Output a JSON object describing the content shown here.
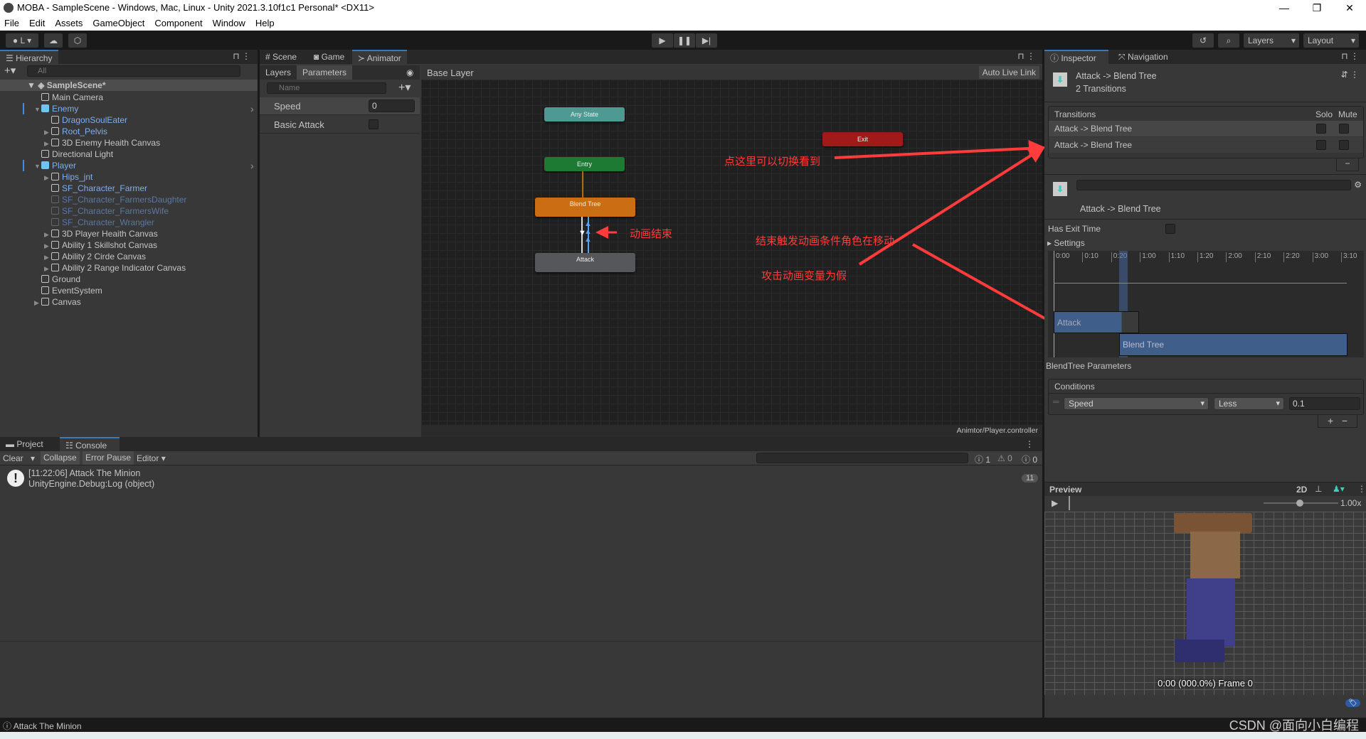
{
  "window": {
    "title": "MOBA - SampleScene - Windows, Mac, Linux - Unity 2021.3.10f1c1 Personal* <DX11>",
    "minimize": "—",
    "maximize": "❐",
    "close": "✕"
  },
  "menu": [
    "File",
    "Edit",
    "Assets",
    "GameObject",
    "Component",
    "Window",
    "Help"
  ],
  "toolbar": {
    "account": "L",
    "layers": "Layers",
    "layout": "Layout"
  },
  "hierarchy": {
    "tab": "Hierarchy",
    "search_placeholder": "All",
    "scene": "SampleScene*",
    "items": [
      {
        "label": "Main Camera",
        "depth": 1,
        "style": "normal",
        "expand": ""
      },
      {
        "label": "Enemy",
        "depth": 1,
        "style": "prefab",
        "expand": "▼"
      },
      {
        "label": "DragonSoulEater",
        "depth": 2,
        "style": "blue",
        "expand": ""
      },
      {
        "label": "Root_Pelvis",
        "depth": 2,
        "style": "blue",
        "expand": "▶"
      },
      {
        "label": "3D Enemy Heaith Canvas",
        "depth": 2,
        "style": "normal",
        "expand": "▶"
      },
      {
        "label": "Directional Light",
        "depth": 1,
        "style": "normal",
        "expand": ""
      },
      {
        "label": "Player",
        "depth": 1,
        "style": "prefab",
        "expand": "▼"
      },
      {
        "label": "Hips_jnt",
        "depth": 2,
        "style": "blue",
        "expand": "▶"
      },
      {
        "label": "SF_Character_Farmer",
        "depth": 2,
        "style": "blue",
        "expand": ""
      },
      {
        "label": "SF_Character_FarmersDaughter",
        "depth": 2,
        "style": "dim",
        "expand": ""
      },
      {
        "label": "SF_Character_FarmersWife",
        "depth": 2,
        "style": "dim",
        "expand": ""
      },
      {
        "label": "SF_Character_Wrangler",
        "depth": 2,
        "style": "dim",
        "expand": ""
      },
      {
        "label": "3D Player Heaith Canvas",
        "depth": 2,
        "style": "normal",
        "expand": "▶"
      },
      {
        "label": "Ability 1 Skillshot Canvas",
        "depth": 2,
        "style": "normal",
        "expand": "▶"
      },
      {
        "label": "Ability 2 Cirde Canvas",
        "depth": 2,
        "style": "normal",
        "expand": "▶"
      },
      {
        "label": "Ability 2 Range Indicator Canvas",
        "depth": 2,
        "style": "normal",
        "expand": "▶"
      },
      {
        "label": "Ground",
        "depth": 1,
        "style": "normal",
        "expand": ""
      },
      {
        "label": "EventSystem",
        "depth": 1,
        "style": "normal",
        "expand": ""
      },
      {
        "label": "Canvas",
        "depth": 1,
        "style": "normal",
        "expand": "▶"
      }
    ]
  },
  "animator": {
    "tabs": [
      "Scene",
      "Game",
      "Animator"
    ],
    "subtabs": [
      "Layers",
      "Parameters"
    ],
    "search_placeholder": "Name",
    "breadcrumb": "Base Layer",
    "auto_live_link": "Auto Live Link",
    "footer": "Animtor/Player.controller",
    "parameters": [
      {
        "name": "Speed",
        "value": "0"
      },
      {
        "name": "Basic Attack",
        "value": false
      }
    ],
    "nodes": {
      "any_state": "Any State",
      "exit": "Exit",
      "entry": "Entry",
      "blend_tree": "Blend Tree",
      "attack": "Attack"
    },
    "annotations": {
      "switch": "点这里可以切换看到",
      "end": "动画结束",
      "condition": "结束触发动画条件角色在移动",
      "false": "攻击动画变量为假"
    },
    "annotation_color": "#ff3b3b"
  },
  "console": {
    "tabs": [
      "Project",
      "Console"
    ],
    "buttons": [
      "Clear",
      "Collapse",
      "Error Pause",
      "Editor"
    ],
    "counts": {
      "log": "1",
      "warn": "0",
      "error": "0"
    },
    "entries": [
      {
        "line1": "[11:22:06] Attack The Minion",
        "line2": "UnityEngine.Debug:Log (object)",
        "count": "11"
      }
    ]
  },
  "status": "Attack The Minion",
  "inspector": {
    "tabs": [
      "Inspector",
      "Navigation"
    ],
    "title": "Attack -> Blend Tree",
    "subtitle": "2 Transitions",
    "transitions_header": "Transitions",
    "solo": "Solo",
    "mute": "Mute",
    "transitions": [
      "Attack -> Blend Tree",
      "Attack -> Blend Tree"
    ],
    "selected_name": "Attack -> Blend Tree",
    "has_exit_time": "Has Exit Time",
    "settings": "Settings",
    "timeline_ticks": [
      "0:00",
      "0:10",
      "0:20",
      "1:00",
      "1:10",
      "1:20",
      "2:00",
      "2:10",
      "2:20",
      "3:00",
      "3:10"
    ],
    "clips": {
      "from": "Attack",
      "to": "Blend Tree"
    },
    "blendtree_params": "BlendTree Parameters",
    "conditions_header": "Conditions",
    "condition": {
      "param": "Speed",
      "op": "Less",
      "value": "0.1"
    },
    "preview": {
      "label": "Preview",
      "mode": "2D",
      "speed": "1.00x",
      "frame": "0:00 (000.0%) Frame 0"
    }
  },
  "watermark": "CSDN @面向小白编程"
}
